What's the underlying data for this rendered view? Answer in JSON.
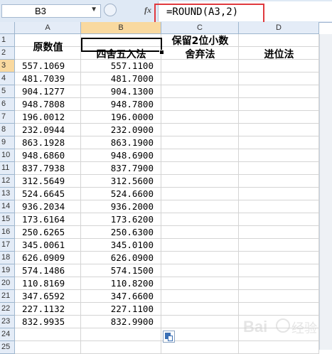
{
  "formula_bar": {
    "name_box": "B3",
    "fx_label": "fx",
    "formula": "=ROUND(A3,2)"
  },
  "columns": [
    "A",
    "B",
    "C",
    "D"
  ],
  "rows": [
    "1",
    "2",
    "3",
    "4",
    "5",
    "6",
    "7",
    "8",
    "9",
    "10",
    "11",
    "12",
    "13",
    "14",
    "15",
    "16",
    "17",
    "18",
    "19",
    "20",
    "21",
    "22",
    "23",
    "24",
    "25"
  ],
  "headers": {
    "a": "原数值",
    "b": "四舍五入法",
    "c_top": "保留2位小数",
    "c_sub": "舍弃法",
    "d": "进位法"
  },
  "data_rows": [
    [
      "557.1069",
      "557.1100"
    ],
    [
      "481.7039",
      "481.7000"
    ],
    [
      "904.1277",
      "904.1300"
    ],
    [
      "948.7808",
      "948.7800"
    ],
    [
      "196.0012",
      "196.0000"
    ],
    [
      "232.0944",
      "232.0900"
    ],
    [
      "863.1928",
      "863.1900"
    ],
    [
      "948.6860",
      "948.6900"
    ],
    [
      "837.7938",
      "837.7900"
    ],
    [
      "312.5649",
      "312.5600"
    ],
    [
      "524.6645",
      "524.6600"
    ],
    [
      "936.2034",
      "936.2000"
    ],
    [
      "173.6164",
      "173.6200"
    ],
    [
      "250.6265",
      "250.6300"
    ],
    [
      "345.0061",
      "345.0100"
    ],
    [
      "626.0909",
      "626.0900"
    ],
    [
      "574.1486",
      "574.1500"
    ],
    [
      "110.8169",
      "110.8200"
    ],
    [
      "347.6592",
      "347.6600"
    ],
    [
      "227.1132",
      "227.1100"
    ],
    [
      "832.9935",
      "832.9900"
    ]
  ],
  "watermark": "Bai 经验"
}
